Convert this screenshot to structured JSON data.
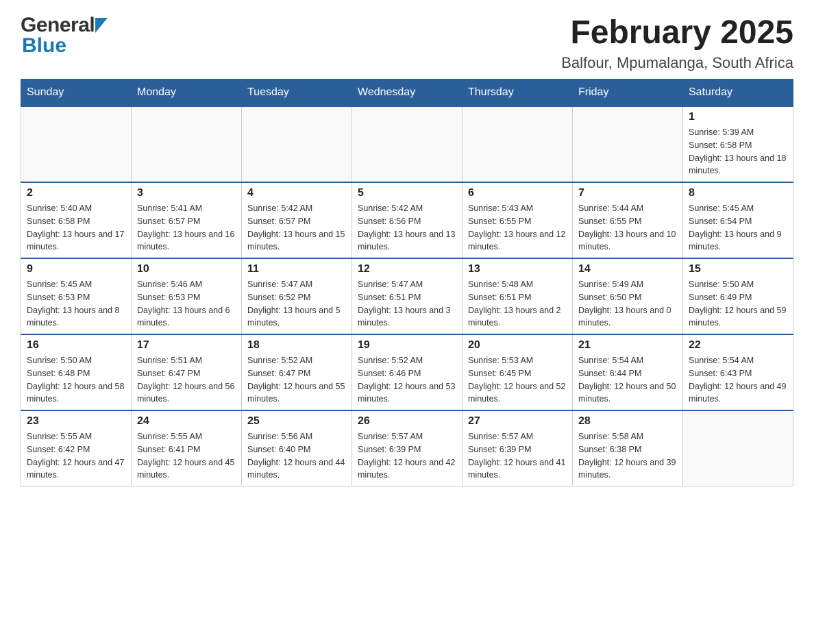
{
  "header": {
    "logo": {
      "general": "General",
      "blue": "Blue"
    },
    "title": "February 2025",
    "location": "Balfour, Mpumalanga, South Africa"
  },
  "days_of_week": [
    "Sunday",
    "Monday",
    "Tuesday",
    "Wednesday",
    "Thursday",
    "Friday",
    "Saturday"
  ],
  "weeks": [
    {
      "days": [
        {
          "number": "",
          "info": ""
        },
        {
          "number": "",
          "info": ""
        },
        {
          "number": "",
          "info": ""
        },
        {
          "number": "",
          "info": ""
        },
        {
          "number": "",
          "info": ""
        },
        {
          "number": "",
          "info": ""
        },
        {
          "number": "1",
          "info": "Sunrise: 5:39 AM\nSunset: 6:58 PM\nDaylight: 13 hours and 18 minutes."
        }
      ]
    },
    {
      "days": [
        {
          "number": "2",
          "info": "Sunrise: 5:40 AM\nSunset: 6:58 PM\nDaylight: 13 hours and 17 minutes."
        },
        {
          "number": "3",
          "info": "Sunrise: 5:41 AM\nSunset: 6:57 PM\nDaylight: 13 hours and 16 minutes."
        },
        {
          "number": "4",
          "info": "Sunrise: 5:42 AM\nSunset: 6:57 PM\nDaylight: 13 hours and 15 minutes."
        },
        {
          "number": "5",
          "info": "Sunrise: 5:42 AM\nSunset: 6:56 PM\nDaylight: 13 hours and 13 minutes."
        },
        {
          "number": "6",
          "info": "Sunrise: 5:43 AM\nSunset: 6:55 PM\nDaylight: 13 hours and 12 minutes."
        },
        {
          "number": "7",
          "info": "Sunrise: 5:44 AM\nSunset: 6:55 PM\nDaylight: 13 hours and 10 minutes."
        },
        {
          "number": "8",
          "info": "Sunrise: 5:45 AM\nSunset: 6:54 PM\nDaylight: 13 hours and 9 minutes."
        }
      ]
    },
    {
      "days": [
        {
          "number": "9",
          "info": "Sunrise: 5:45 AM\nSunset: 6:53 PM\nDaylight: 13 hours and 8 minutes."
        },
        {
          "number": "10",
          "info": "Sunrise: 5:46 AM\nSunset: 6:53 PM\nDaylight: 13 hours and 6 minutes."
        },
        {
          "number": "11",
          "info": "Sunrise: 5:47 AM\nSunset: 6:52 PM\nDaylight: 13 hours and 5 minutes."
        },
        {
          "number": "12",
          "info": "Sunrise: 5:47 AM\nSunset: 6:51 PM\nDaylight: 13 hours and 3 minutes."
        },
        {
          "number": "13",
          "info": "Sunrise: 5:48 AM\nSunset: 6:51 PM\nDaylight: 13 hours and 2 minutes."
        },
        {
          "number": "14",
          "info": "Sunrise: 5:49 AM\nSunset: 6:50 PM\nDaylight: 13 hours and 0 minutes."
        },
        {
          "number": "15",
          "info": "Sunrise: 5:50 AM\nSunset: 6:49 PM\nDaylight: 12 hours and 59 minutes."
        }
      ]
    },
    {
      "days": [
        {
          "number": "16",
          "info": "Sunrise: 5:50 AM\nSunset: 6:48 PM\nDaylight: 12 hours and 58 minutes."
        },
        {
          "number": "17",
          "info": "Sunrise: 5:51 AM\nSunset: 6:47 PM\nDaylight: 12 hours and 56 minutes."
        },
        {
          "number": "18",
          "info": "Sunrise: 5:52 AM\nSunset: 6:47 PM\nDaylight: 12 hours and 55 minutes."
        },
        {
          "number": "19",
          "info": "Sunrise: 5:52 AM\nSunset: 6:46 PM\nDaylight: 12 hours and 53 minutes."
        },
        {
          "number": "20",
          "info": "Sunrise: 5:53 AM\nSunset: 6:45 PM\nDaylight: 12 hours and 52 minutes."
        },
        {
          "number": "21",
          "info": "Sunrise: 5:54 AM\nSunset: 6:44 PM\nDaylight: 12 hours and 50 minutes."
        },
        {
          "number": "22",
          "info": "Sunrise: 5:54 AM\nSunset: 6:43 PM\nDaylight: 12 hours and 49 minutes."
        }
      ]
    },
    {
      "days": [
        {
          "number": "23",
          "info": "Sunrise: 5:55 AM\nSunset: 6:42 PM\nDaylight: 12 hours and 47 minutes."
        },
        {
          "number": "24",
          "info": "Sunrise: 5:55 AM\nSunset: 6:41 PM\nDaylight: 12 hours and 45 minutes."
        },
        {
          "number": "25",
          "info": "Sunrise: 5:56 AM\nSunset: 6:40 PM\nDaylight: 12 hours and 44 minutes."
        },
        {
          "number": "26",
          "info": "Sunrise: 5:57 AM\nSunset: 6:39 PM\nDaylight: 12 hours and 42 minutes."
        },
        {
          "number": "27",
          "info": "Sunrise: 5:57 AM\nSunset: 6:39 PM\nDaylight: 12 hours and 41 minutes."
        },
        {
          "number": "28",
          "info": "Sunrise: 5:58 AM\nSunset: 6:38 PM\nDaylight: 12 hours and 39 minutes."
        },
        {
          "number": "",
          "info": ""
        }
      ]
    }
  ]
}
